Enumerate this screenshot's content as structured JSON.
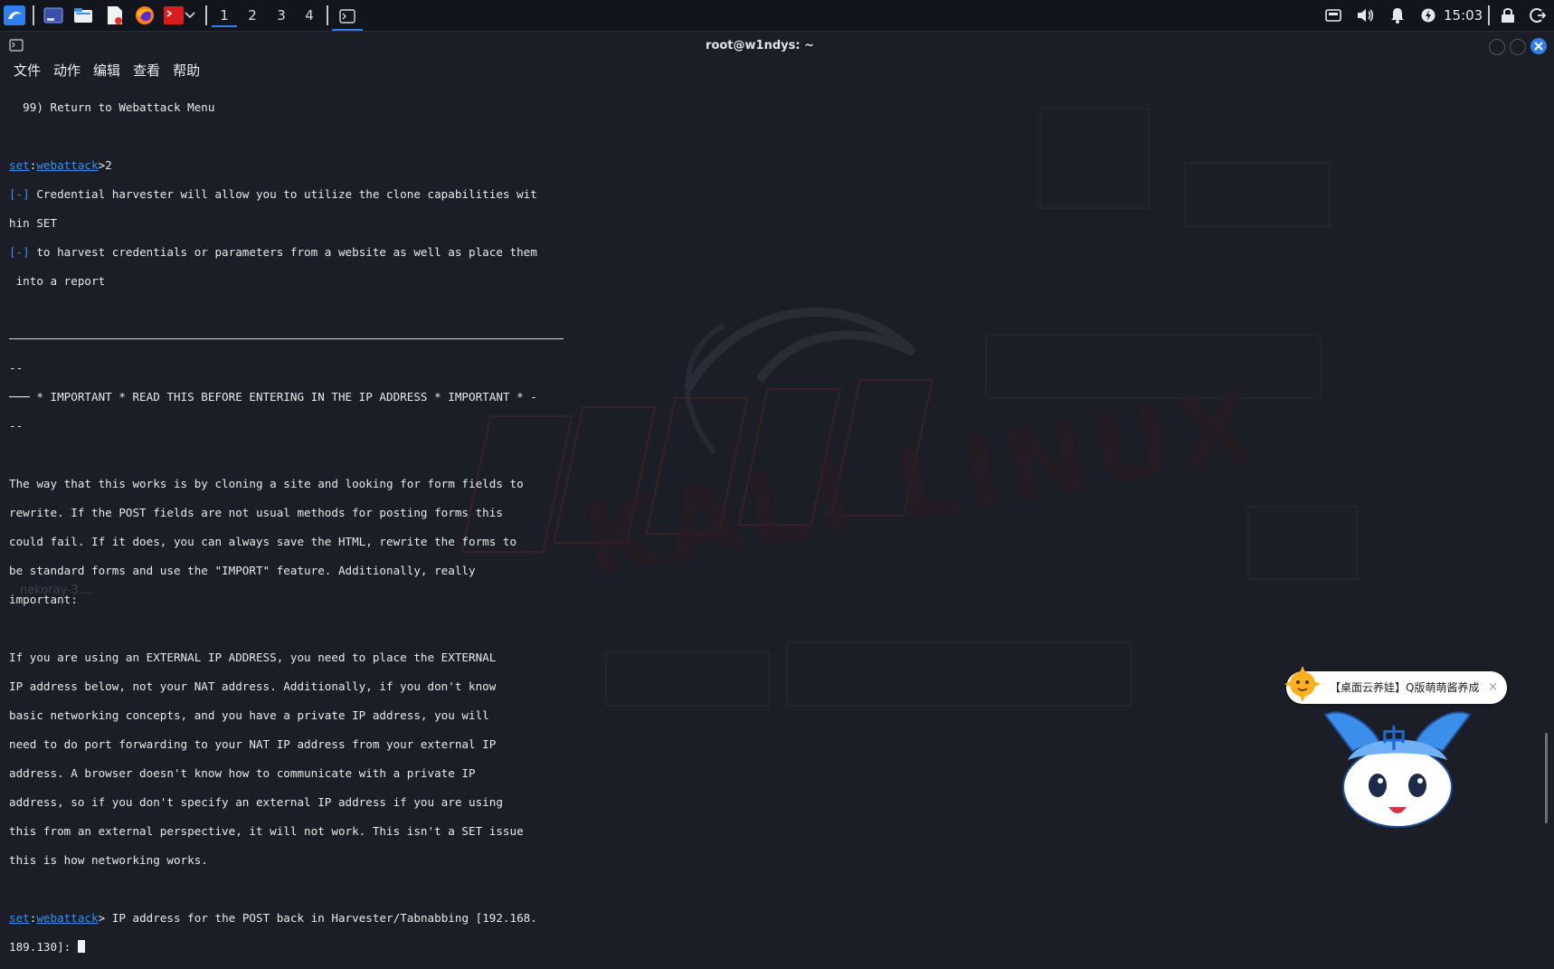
{
  "panel": {
    "workspaces": [
      "1",
      "2",
      "3",
      "4"
    ],
    "active_workspace": "1",
    "clock": "15:03"
  },
  "window": {
    "title": "root@w1ndys: ~"
  },
  "menu": {
    "items": [
      "文件",
      "动作",
      "编辑",
      "查看",
      "帮助"
    ]
  },
  "terminal": {
    "line_return_menu": "  99) Return to Webattack Menu",
    "prompt_set": "set",
    "prompt_colon": ":",
    "prompt_module": "webattack",
    "first_command": ">2",
    "marker": "[-]",
    "info_1a": " Credential harvester will allow you to utilize the clone capabilities wit",
    "info_1b": "hin SET",
    "info_2a": " to harvest credentials or parameters from a website as well as place them",
    "info_2b": " into a report",
    "dashes_1": "--",
    "important_line": "─── * IMPORTANT * READ THIS BEFORE ENTERING IN THE IP ADDRESS * IMPORTANT * -",
    "dashes_2": "--",
    "para1": [
      "The way that this works is by cloning a site and looking for form fields to",
      "rewrite. If the POST fields are not usual methods for posting forms this",
      "could fail. If it does, you can always save the HTML, rewrite the forms to",
      "be standard forms and use the \"IMPORT\" feature. Additionally, really",
      "important:"
    ],
    "para2": [
      "If you are using an EXTERNAL IP ADDRESS, you need to place the EXTERNAL",
      "IP address below, not your NAT address. Additionally, if you don't know",
      "basic networking concepts, and you have a private IP address, you will",
      "need to do port forwarding to your NAT IP address from your external IP",
      "address. A browser doesn't know how to communicate with a private IP",
      "address, so if you don't specify an external IP address if you are using",
      "this from an external perspective, it will not work. This isn't a SET issue",
      "this is how networking works."
    ],
    "ip_prompt_a": "> IP address for the POST back in Harvester/Tabnabbing [192.168.",
    "ip_prompt_b": "189.130]: "
  },
  "wallpaper": {
    "label": "nekoray-3....",
    "logo_text": "KALI LINUX"
  },
  "notification": {
    "text": "【桌面云养娃】Q版萌萌酱养成",
    "close": "×"
  },
  "ime": {
    "label": "中"
  },
  "colors": {
    "prompt_blue": "#3b8eea",
    "accent": "#2f80ed",
    "close_button": "#2f80ed"
  }
}
